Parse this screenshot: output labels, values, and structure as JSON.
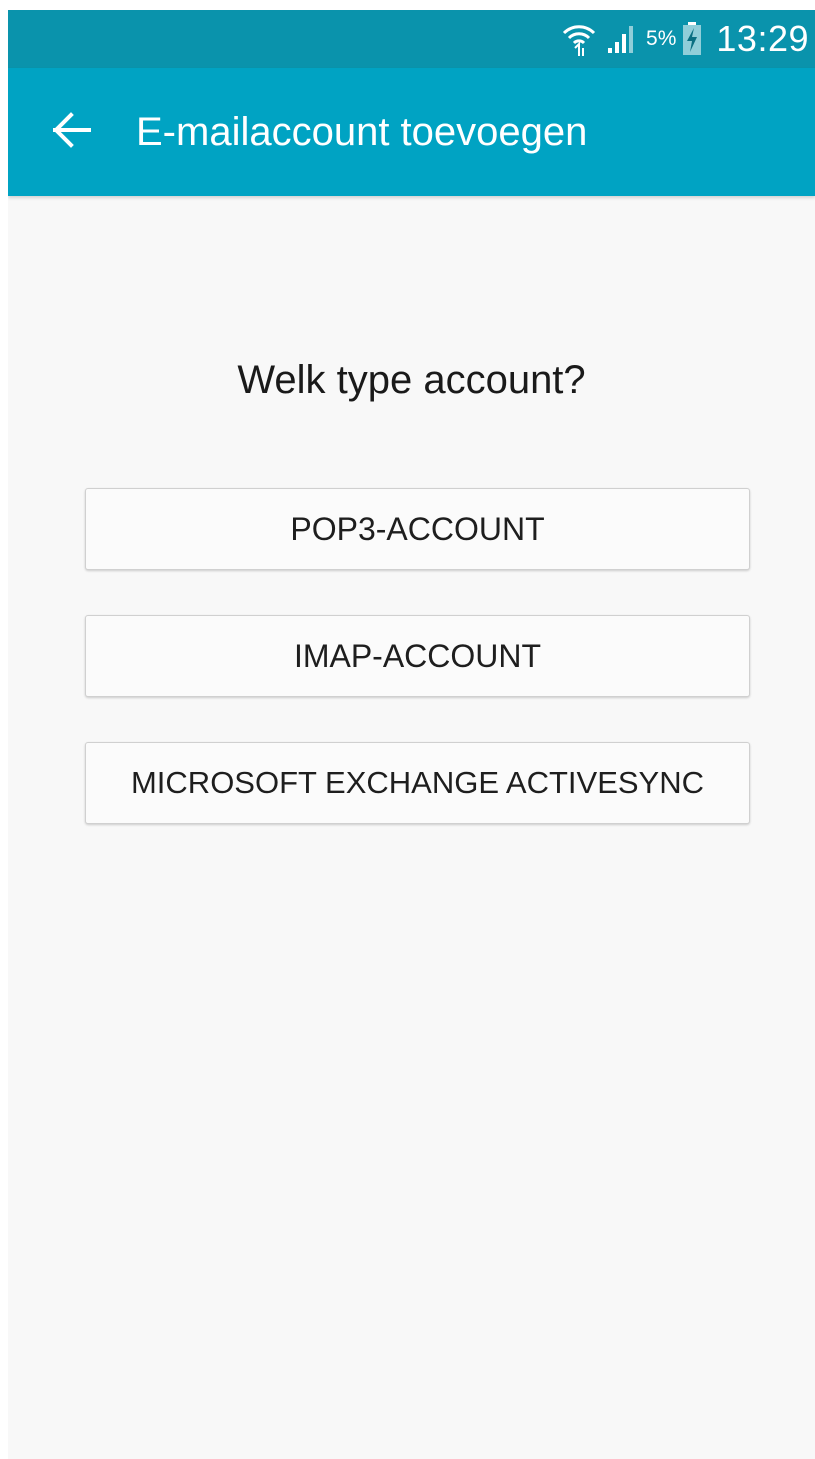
{
  "status_bar": {
    "icons": [
      "wifi-icon",
      "signal-icon",
      "battery-charging-icon"
    ],
    "battery_percent": "5%",
    "time": "13:29"
  },
  "app_bar": {
    "back_icon": "arrow-left-icon",
    "title": "E-mailaccount toevoegen",
    "color": "#00a3c3"
  },
  "main": {
    "question": "Welk type account?",
    "options": [
      {
        "label": "POP3-ACCOUNT"
      },
      {
        "label": "IMAP-ACCOUNT"
      },
      {
        "label": "MICROSOFT EXCHANGE ACTIVESYNC"
      }
    ]
  },
  "colors": {
    "status_bar": "#0a93ac",
    "app_bar": "#00a3c3",
    "background": "#f8f8f8"
  }
}
